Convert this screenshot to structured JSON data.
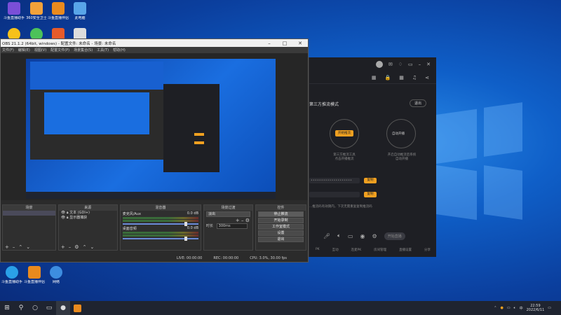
{
  "desktop": {
    "icons": [
      {
        "label": "斗鱼直播助手",
        "color": "#7a4fd8"
      },
      {
        "label": "360安全卫士",
        "color": "#f2a23a"
      },
      {
        "label": "斗鱼直播伴侣",
        "color": "#e98a1e"
      },
      {
        "label": "此电脑",
        "color": "#58a5e8"
      },
      {
        "label": "",
        "color": "#f7c11a"
      },
      {
        "label": "",
        "color": "#4cc25a"
      },
      {
        "label": "",
        "color": "#e65b2a"
      },
      {
        "label": "",
        "color": "#dddddd"
      }
    ],
    "bottom_icons": [
      {
        "label": "斗鱼直播助手",
        "color": "#2aa0e8"
      },
      {
        "label": "斗鱼直播伴侣",
        "color": "#e98a1e"
      },
      {
        "label": "网络",
        "color": "#3d8de0"
      }
    ]
  },
  "obs": {
    "title": "OBS 21.1.2 (64bit, windows) - 配置文件: 未命名 - 场景: 未命名",
    "menu": [
      "文件(F)",
      "编辑(E)",
      "视图(V)",
      "配置文件(P)",
      "场景集合(S)",
      "工具(T)",
      "帮助(H)"
    ],
    "docks": {
      "scenes_title": "场景",
      "sources_title": "来源",
      "sources": [
        "文本 (GDI+)",
        "显示器捕获"
      ],
      "mixer_title": "混音器",
      "mixer": [
        {
          "name": "麦克风/Aux",
          "value": "0.0 dB"
        },
        {
          "name": "桌面音频",
          "value": "0.0 dB"
        }
      ],
      "transitions_title": "场景过渡",
      "transition_value": "淡出",
      "duration_label": "时长",
      "duration_value": "300ms",
      "controls_title": "控件",
      "controls": [
        "停止推流",
        "开始录制",
        "工作室模式",
        "设置",
        "退出"
      ]
    },
    "status": {
      "live": "LIVE: 00:00:00",
      "rec": "REC: 00:00:00",
      "cpu": "CPU: 3.0%, 30.00 fps"
    }
  },
  "live_app": {
    "mode_title": "第三方推流模式",
    "exit_label": "退出",
    "start_label": "开始推流",
    "auto_label": "自动开播",
    "desc_left": "第三方推流工具\n点击开播推流",
    "desc_right": "开启自动推流后系统\n自动开播",
    "copy_label": "复制",
    "note": "...推流码有效期内，下次无需重复复制推流码",
    "bottom": [
      "麦克风",
      "扬声器",
      "场景",
      "直播助手",
      "直播设置"
    ],
    "bottom_labels": [
      "PK",
      "互动",
      "连麦PK",
      "房间管理",
      "直播设置",
      "分享"
    ],
    "start_live": "开始直播"
  },
  "taskbar": {
    "time": "22:59",
    "date": "2022/6/11",
    "ime": "中"
  }
}
